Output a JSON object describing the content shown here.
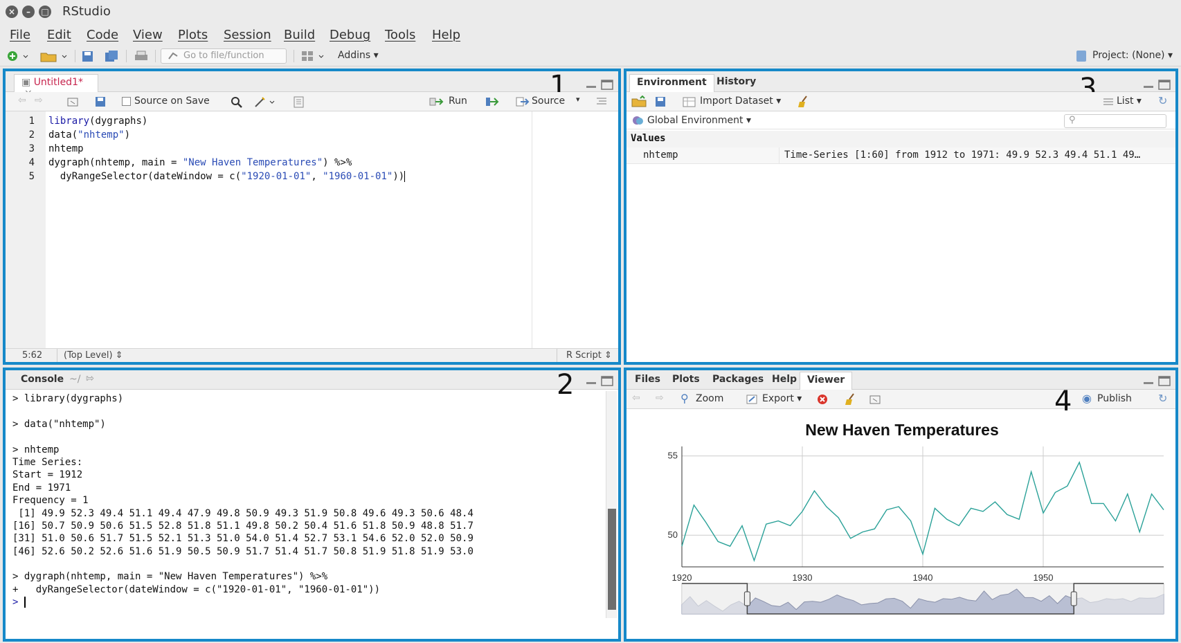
{
  "window": {
    "title": "RStudio"
  },
  "menu": [
    "File",
    "Edit",
    "Code",
    "View",
    "Plots",
    "Session",
    "Build",
    "Debug",
    "Tools",
    "Help"
  ],
  "toolbar": {
    "goto_placeholder": "Go to file/function",
    "addins": "Addins ▾",
    "project": "Project: (None) ▾"
  },
  "editor": {
    "number": "1",
    "tab": "Untitled1*",
    "source_on_save": "Source on Save",
    "run": "Run",
    "source": "Source",
    "lines": [
      {
        "n": "1",
        "text": "library(dygraphs)"
      },
      {
        "n": "2",
        "text": "data(\"nhtemp\")"
      },
      {
        "n": "3",
        "text": "nhtemp"
      },
      {
        "n": "4",
        "text": "dygraph(nhtemp, main = \"New Haven Temperatures\") %>%"
      },
      {
        "n": "5",
        "text": "  dyRangeSelector(dateWindow = c(\"1920-01-01\", \"1960-01-01\"))"
      }
    ],
    "status": {
      "position": "5:62",
      "scope": "(Top Level) ⇕",
      "type": "R Script ⇕"
    }
  },
  "console": {
    "number": "2",
    "title": "Console",
    "path": "~/",
    "lines": [
      "> library(dygraphs)",
      "",
      "> data(\"nhtemp\")",
      "",
      "> nhtemp",
      "Time Series:",
      "Start = 1912",
      "End = 1971",
      "Frequency = 1",
      " [1] 49.9 52.3 49.4 51.1 49.4 47.9 49.8 50.9 49.3 51.9 50.8 49.6 49.3 50.6 48.4",
      "[16] 50.7 50.9 50.6 51.5 52.8 51.8 51.1 49.8 50.2 50.4 51.6 51.8 50.9 48.8 51.7",
      "[31] 51.0 50.6 51.7 51.5 52.1 51.3 51.0 54.0 51.4 52.7 53.1 54.6 52.0 52.0 50.9",
      "[46] 52.6 50.2 52.6 51.6 51.9 50.5 50.9 51.7 51.4 51.7 50.8 51.9 51.8 51.9 53.0",
      "",
      "> dygraph(nhtemp, main = \"New Haven Temperatures\") %>%",
      "+   dyRangeSelector(dateWindow = c(\"1920-01-01\", \"1960-01-01\"))",
      "> "
    ]
  },
  "environment": {
    "number": "3",
    "tabs": [
      "Environment",
      "History"
    ],
    "import": "Import Dataset ▾",
    "list": "List ▾",
    "scope": "Global Environment ▾",
    "section": "Values",
    "rows": [
      {
        "name": "nhtemp",
        "value": "Time-Series [1:60] from 1912 to 1971: 49.9 52.3 49.4 51.1 49…"
      }
    ]
  },
  "viewer": {
    "number": "4",
    "tabs": [
      "Files",
      "Plots",
      "Packages",
      "Help",
      "Viewer"
    ],
    "zoom": "Zoom",
    "export": "Export ▾",
    "publish": "Publish"
  },
  "chart_data": {
    "type": "line",
    "title": "New Haven Temperatures",
    "x_start": 1912,
    "values": [
      49.9,
      52.3,
      49.4,
      51.1,
      49.4,
      47.9,
      49.8,
      50.9,
      49.3,
      51.9,
      50.8,
      49.6,
      49.3,
      50.6,
      48.4,
      50.7,
      50.9,
      50.6,
      51.5,
      52.8,
      51.8,
      51.1,
      49.8,
      50.2,
      50.4,
      51.6,
      51.8,
      50.9,
      48.8,
      51.7,
      51.0,
      50.6,
      51.7,
      51.5,
      52.1,
      51.3,
      51.0,
      54.0,
      51.4,
      52.7,
      53.1,
      54.6,
      52.0,
      52.0,
      50.9,
      52.6,
      50.2,
      52.6,
      51.6,
      51.9,
      50.5,
      50.9,
      51.7,
      51.4,
      51.7,
      50.8,
      51.9,
      51.8,
      51.9,
      53.0
    ],
    "xlim": [
      1920,
      1960
    ],
    "ylim": [
      48,
      55.6
    ],
    "x_ticks": [
      "1920",
      "1930",
      "1940",
      "1950"
    ],
    "y_ticks": [
      "50",
      "55"
    ],
    "range_selector": {
      "from": 1920,
      "to": 1960
    },
    "series_color": "#2aa198"
  }
}
